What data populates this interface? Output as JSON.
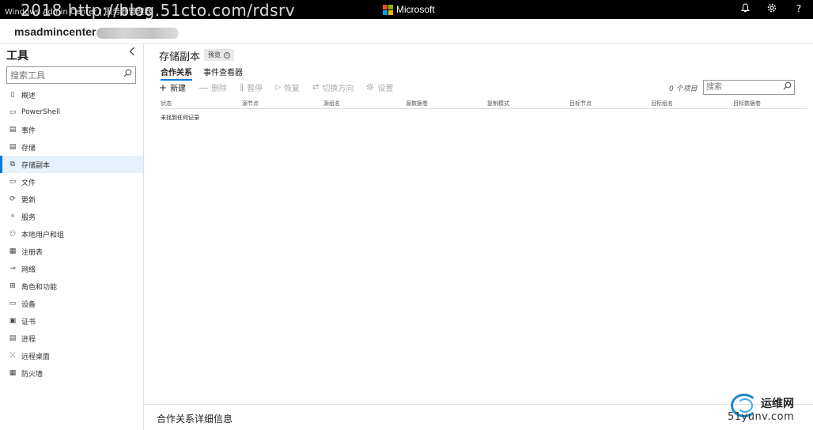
{
  "topbar": {
    "app_title": "Windows Admin Center  |  服务器管理器",
    "watermark": "2018 http://blog.51cto.com/rdsrv",
    "brand": "Microsoft",
    "brand_colors": [
      "#f25022",
      "#7fba00",
      "#00a4ef",
      "#ffb900"
    ],
    "icons": [
      "bell-icon",
      "gear-icon",
      "help-icon"
    ]
  },
  "server": {
    "name": "msadmincenter"
  },
  "sidebar": {
    "title": "工具",
    "search_placeholder": "搜索工具",
    "items": [
      {
        "label": "概述",
        "icon": "device-icon"
      },
      {
        "label": "PowerShell",
        "icon": "powershell-icon"
      },
      {
        "label": "事件",
        "icon": "event-icon"
      },
      {
        "label": "存储",
        "icon": "storage-icon"
      },
      {
        "label": "存储副本",
        "icon": "storage-replica-icon",
        "active": true
      },
      {
        "label": "文件",
        "icon": "folder-icon"
      },
      {
        "label": "更新",
        "icon": "update-icon"
      },
      {
        "label": "服务",
        "icon": "services-icon"
      },
      {
        "label": "本地用户和组",
        "icon": "users-icon"
      },
      {
        "label": "注册表",
        "icon": "registry-icon"
      },
      {
        "label": "网络",
        "icon": "network-icon"
      },
      {
        "label": "角色和功能",
        "icon": "roles-icon"
      },
      {
        "label": "设备",
        "icon": "devices-icon"
      },
      {
        "label": "证书",
        "icon": "certificate-icon"
      },
      {
        "label": "进程",
        "icon": "process-icon"
      },
      {
        "label": "远程桌面",
        "icon": "remote-desktop-icon"
      },
      {
        "label": "防火墙",
        "icon": "firewall-icon"
      }
    ]
  },
  "main": {
    "title": "存储副本",
    "preview_badge": "预览",
    "tabs": [
      {
        "label": "合作关系",
        "active": true
      },
      {
        "label": "事件查看器",
        "active": false
      }
    ],
    "toolbar": {
      "new": "新建",
      "delete": "删除",
      "pause": "暂停",
      "resume": "恢复",
      "switch_direction": "切换方向",
      "settings": "设置"
    },
    "item_count": "0 个项目",
    "search_placeholder": "搜索",
    "columns": [
      "状态",
      "源节点",
      "源组名",
      "源数据卷",
      "复制模式",
      "目标节点",
      "目标组名",
      "目标数据卷"
    ],
    "empty_message": "未找到任何记录",
    "details_title": "合作关系详细信息"
  },
  "logo_watermark": {
    "cn": "运维网",
    "site": "51yunv.com"
  }
}
